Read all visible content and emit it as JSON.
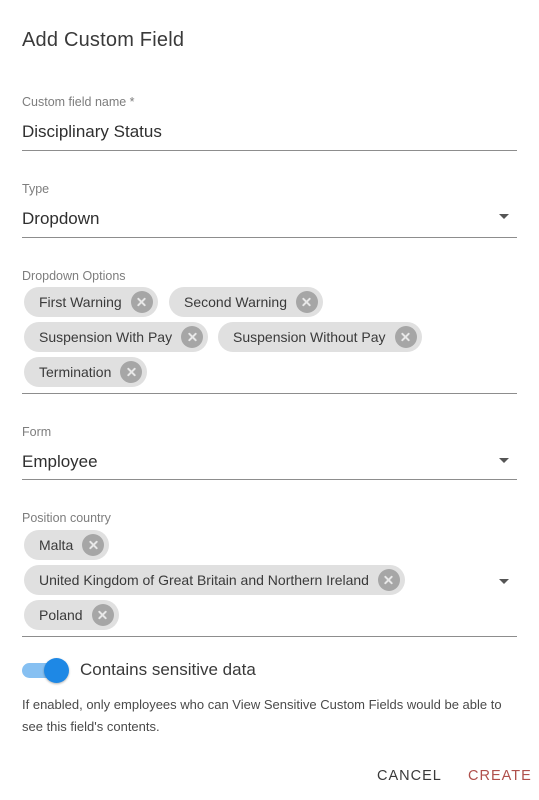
{
  "dialog": {
    "title": "Add Custom Field"
  },
  "fields": {
    "name": {
      "label": "Custom field name *",
      "value": "Disciplinary Status"
    },
    "type": {
      "label": "Type",
      "value": "Dropdown"
    },
    "options": {
      "label": "Dropdown Options",
      "chips": [
        "First Warning",
        "Second Warning",
        "Suspension With Pay",
        "Suspension Without Pay",
        "Termination"
      ]
    },
    "form": {
      "label": "Form",
      "value": "Employee"
    },
    "country": {
      "label": "Position country",
      "chips": [
        "Malta",
        "United Kingdom of Great Britain and Northern Ireland",
        "Poland"
      ]
    }
  },
  "sensitive": {
    "label": "Contains sensitive data",
    "enabled": true,
    "helper": "If enabled, only employees who can View Sensitive Custom Fields would be able to see this field's contents."
  },
  "actions": {
    "cancel": "CANCEL",
    "create": "CREATE"
  },
  "colors": {
    "accent": "#1e88e5",
    "create": "#b0504c",
    "chip": "#e0e0e0"
  }
}
